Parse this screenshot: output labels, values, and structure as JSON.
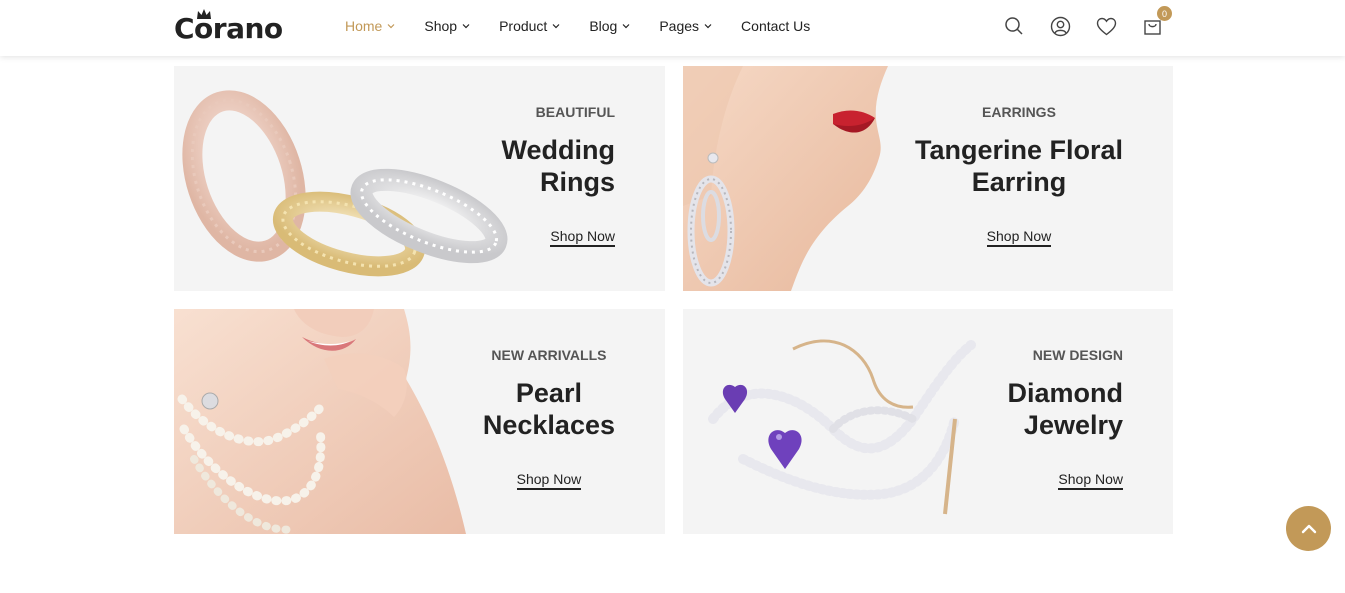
{
  "brand": {
    "logo_text": "Corano",
    "accent": "#c29958"
  },
  "nav": [
    {
      "label": "Home",
      "active": true,
      "has_dropdown": true
    },
    {
      "label": "Shop",
      "active": false,
      "has_dropdown": true
    },
    {
      "label": "Product",
      "active": false,
      "has_dropdown": true
    },
    {
      "label": "Blog",
      "active": false,
      "has_dropdown": true
    },
    {
      "label": "Pages",
      "active": false,
      "has_dropdown": true
    },
    {
      "label": "Contact Us",
      "active": false,
      "has_dropdown": false
    }
  ],
  "header_icons": {
    "search": "search-icon",
    "account": "user-icon",
    "wishlist": "heart-icon",
    "cart": "cart-icon",
    "cart_count": "0"
  },
  "banners": [
    {
      "subtitle": "BEAUTIFUL",
      "title_line1": "Wedding",
      "title_line2": "Rings",
      "cta": "Shop Now",
      "image": "rings-image"
    },
    {
      "subtitle": "EARRINGS",
      "title_line1": "Tangerine Floral",
      "title_line2": "Earring",
      "cta": "Shop Now",
      "image": "earring-model-image"
    },
    {
      "subtitle": "NEW ARRIVALLS",
      "title_line1": "Pearl",
      "title_line2": "Necklaces",
      "cta": "Shop Now",
      "image": "necklace-model-image"
    },
    {
      "subtitle": "NEW DESIGN",
      "title_line1": "Diamond",
      "title_line2": "Jewelry",
      "cta": "Shop Now",
      "image": "diamond-shoe-brooch-image"
    }
  ],
  "scroll_top": {
    "icon": "chevron-up-icon"
  }
}
